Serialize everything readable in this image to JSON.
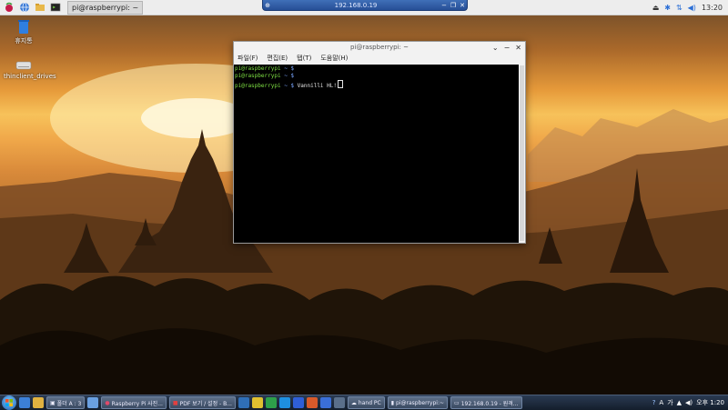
{
  "rdp_bar": {
    "title": "192.168.0.19",
    "pin_glyph": "⊕",
    "min_glyph": "−",
    "max_glyph": "❐",
    "close_glyph": "✕"
  },
  "top_panel": {
    "task_label": "pi@raspberrypi: ~",
    "clock": "13:20",
    "icons": [
      "raspberry-menu-icon",
      "browser-icon",
      "file-manager-icon",
      "terminal-icon",
      "mathematica-icon",
      "wolfram-icon"
    ]
  },
  "desktop": {
    "icons": [
      {
        "label": "휴지통",
        "name": "trash-desktop-icon"
      },
      {
        "label": "thinclient_drives",
        "name": "drive-desktop-icon"
      }
    ]
  },
  "terminal": {
    "title": "pi@raspberrypi: ~",
    "menu": [
      "파일(F)",
      "편집(E)",
      "탭(T)",
      "도움말(H)"
    ],
    "lines": [
      {
        "user": "pi@raspberrypi",
        "path": " ~ $",
        "cmd": ""
      },
      {
        "user": "pi@raspberrypi",
        "path": " ~ $",
        "cmd": ""
      },
      {
        "user": "pi@raspberrypi",
        "path": " ~ $",
        "cmd": " Vannilli HL!"
      }
    ]
  },
  "taskbar": {
    "start_label": "Start",
    "buttons": [
      "폴더 A : 3",
      "Raspberry Pi 사진...",
      "PDF 보기 / 설정 - B...",
      "hand PC",
      "pi@raspberrypi:~",
      "192.168.0.19 - 원격..."
    ],
    "tray": {
      "lang": "A",
      "ime": "가",
      "time": "오후 1:20"
    },
    "colors": {
      "accent": "#2a3a52",
      "prompt_green": "#7ee043",
      "path_blue": "#7aa7ff"
    }
  }
}
